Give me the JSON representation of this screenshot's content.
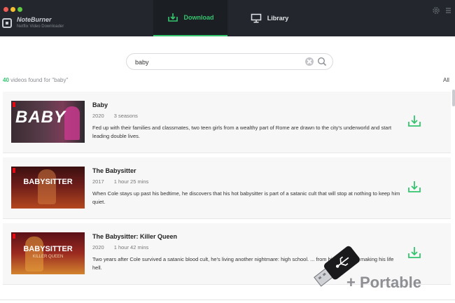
{
  "window": {
    "app_name": "NoteBurner",
    "app_subtitle": "Netflix Video Downloader",
    "icons": {
      "settings": "gear-icon",
      "menu": "menu-icon"
    }
  },
  "tabs": [
    {
      "label": "Download",
      "icon": "download-tab-icon",
      "active": true
    },
    {
      "label": "Library",
      "icon": "monitor-icon",
      "active": false
    }
  ],
  "search": {
    "value": "baby",
    "clear_icon": "clear-icon",
    "search_icon": "search-icon"
  },
  "results": {
    "count": "40",
    "summary_text": "videos found for \"baby\"",
    "filter": "All"
  },
  "videos": [
    {
      "thumb_text": "BABY",
      "title": "Baby",
      "year": "2020",
      "duration": "3 seasons",
      "description": "Fed up with their families and classmates, two teen girls from a wealthy part of Rome are drawn to the city's underworld and start leading double lives."
    },
    {
      "thumb_text": "BABYSITTER",
      "title": "The Babysitter",
      "year": "2017",
      "duration": "1 hour 25 mins",
      "description": "When Cole stays up past his bedtime, he discovers that his hot babysitter is part of a satanic cult that will stop at nothing to keep him quiet."
    },
    {
      "thumb_text": "BABYSITTER",
      "thumb_subtext": "KILLER QUEEN",
      "title": "The Babysitter: Killer Queen",
      "year": "2020",
      "duration": "1 hour 42 mins",
      "description": "Two years after Cole survived a satanic blood cult, he's living another nightmare: high school. ... from his past? Still making his life hell."
    }
  ],
  "overlay": {
    "text": "+ Portable",
    "icon": "usb-drive-icon"
  },
  "colors": {
    "accent": "#35c56f",
    "titlebar": "#23272d",
    "netflix_red": "#e50914"
  }
}
